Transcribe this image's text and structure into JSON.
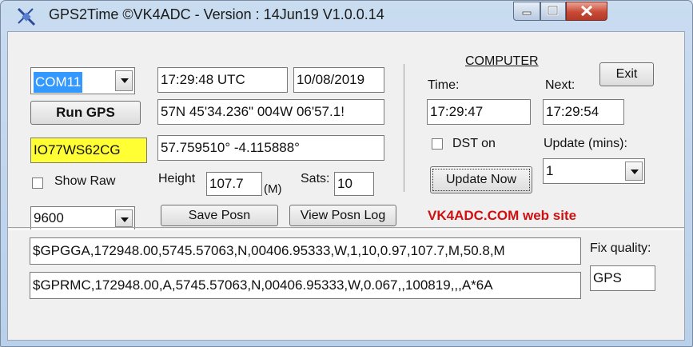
{
  "window": {
    "title": "GPS2Time  ©VK4ADC - Version : 14Jun19 V1.0.0.14"
  },
  "gps": {
    "com_port": "COM11",
    "run_label": "Run GPS",
    "time_utc": "17:29:48 UTC",
    "date": "10/08/2019",
    "position_dms": "57N 45'34.236\" 004W 06'57.1!",
    "locator": "IO77WS62CG",
    "position_decimal": "57.759510° -4.115888°",
    "show_raw_label": "Show Raw",
    "height_label": "Height",
    "height_value": "107.7",
    "height_unit": "(M)",
    "sats_label": "Sats:",
    "sats_value": "10",
    "baud": "9600",
    "save_label": "Save Posn",
    "view_log_label": "View Posn Log"
  },
  "computer": {
    "heading": "COMPUTER",
    "exit_label": "Exit",
    "time_label": "Time:",
    "next_label": "Next:",
    "time_value": "17:29:47",
    "next_value": "17:29:54",
    "dst_label": "DST on",
    "update_mins_label": "Update (mins):",
    "update_mins_value": "1",
    "update_now_label": "Update Now",
    "website_label": "VK4ADC.COM web site"
  },
  "nmea": {
    "gga": "$GPGGA,172948.00,5745.57063,N,00406.95333,W,1,10,0.97,107.7,M,50.8,M",
    "rmc": "$GPRMC,172948.00,A,5745.57063,N,00406.95333,W,0.067,,100819,,,A*6A",
    "fix_label": "Fix quality:",
    "fix_value": "GPS"
  },
  "colors": {
    "accent_red": "#d01010",
    "locator_bg": "#ffff33",
    "com_highlight": "#3399ff"
  },
  "icons": {
    "app": "satellite-icon",
    "minimize": "minimize-icon",
    "maximize": "maximize-icon",
    "close": "close-icon"
  }
}
